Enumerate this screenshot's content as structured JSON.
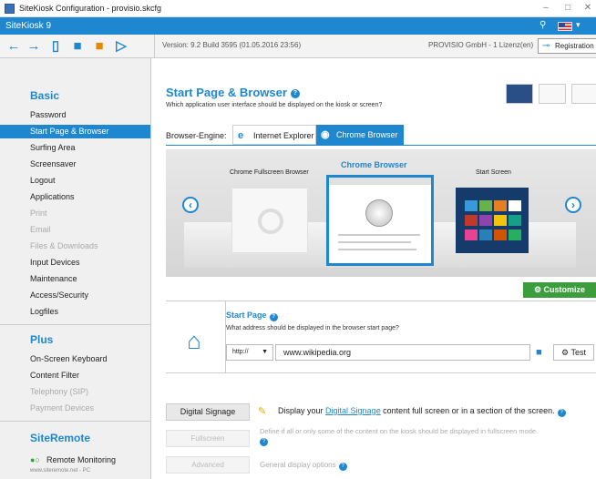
{
  "window": {
    "title": "SiteKiosk Configuration - provisio.skcfg"
  },
  "bluebar": {
    "brand": "SiteKiosk 9",
    "search_icon": "search-icon",
    "language_flag": "us-flag-icon"
  },
  "toolbar": {
    "version": "Version: 9.2 Build 3595 (01.05.2016 23:56)",
    "license": "PROVISIO GmbH - 1 Lizenz(en)",
    "registration_label": "Registration",
    "buttons": [
      "back-icon",
      "forward-icon",
      "new-file-icon",
      "open-folder-icon",
      "save-icon",
      "export-icon"
    ]
  },
  "sidebar": {
    "basic_title": "Basic",
    "basic_items": [
      {
        "label": "Password",
        "state": "normal"
      },
      {
        "label": "Start Page & Browser",
        "state": "active"
      },
      {
        "label": "Surfing Area",
        "state": "normal"
      },
      {
        "label": "Screensaver",
        "state": "normal"
      },
      {
        "label": "Logout",
        "state": "normal"
      },
      {
        "label": "Applications",
        "state": "normal"
      },
      {
        "label": "Print",
        "state": "disabled"
      },
      {
        "label": "Email",
        "state": "disabled"
      },
      {
        "label": "Files & Downloads",
        "state": "disabled"
      },
      {
        "label": "Input Devices",
        "state": "normal"
      },
      {
        "label": "Maintenance",
        "state": "normal"
      },
      {
        "label": "Access/Security",
        "state": "normal"
      },
      {
        "label": "Logfiles",
        "state": "normal"
      }
    ],
    "plus_title": "Plus",
    "plus_items": [
      {
        "label": "On-Screen Keyboard",
        "state": "normal"
      },
      {
        "label": "Content Filter",
        "state": "normal"
      },
      {
        "label": "Telephony (SIP)",
        "state": "disabled"
      },
      {
        "label": "Payment Devices",
        "state": "disabled"
      }
    ],
    "remote_title": "SiteRemote",
    "remote_item": "Remote Monitoring",
    "remote_sub": "www.siteremote.net - PC"
  },
  "main": {
    "title": "Start Page & Browser",
    "subtitle": "Which application user interface should be displayed on the kiosk or screen?",
    "engine_label": "Browser-Engine:",
    "engines": [
      {
        "label": "Internet Explorer",
        "selected": false
      },
      {
        "label": "Chrome Browser",
        "selected": true
      }
    ],
    "carousel": {
      "left_label": "Chrome Fullscreen Browser",
      "center_label": "Chrome Browser",
      "right_label": "Start Screen"
    },
    "customize_label": "Customize",
    "start_page": {
      "title": "Start Page",
      "description": "What address should be displayed in the browser start page?",
      "protocol": "http://",
      "url": "www.wikipedia.org",
      "test_label": "Test"
    },
    "signage": {
      "button": "Digital Signage",
      "text_before": "Display your ",
      "link": "Digital Signage",
      "text_after": " content full screen or in a section of the screen."
    },
    "fullscreen": {
      "button": "Fullscreen",
      "text": "Define if all or only some of the content on the kiosk should be displayed in fullscreen mode."
    },
    "advanced": {
      "button": "Advanced",
      "text": "General display options"
    }
  },
  "colors": {
    "accent": "#1f87cf",
    "customize": "#3c9d3c",
    "signage_icon": "#e6a800"
  }
}
